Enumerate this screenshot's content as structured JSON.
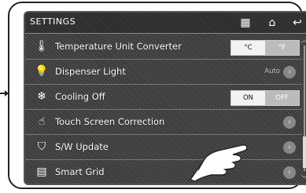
{
  "header": {
    "title": "SETTINGS"
  },
  "toolbar": {
    "icons": [
      "grid-settings-icon",
      "home-icon",
      "back-icon"
    ],
    "home_glyph": "⌂",
    "back_glyph": "↩",
    "grid_glyph": "▦"
  },
  "settings": {
    "temperature": {
      "label": "Temperature Unit Converter",
      "options": [
        "°C",
        "°F"
      ],
      "selected": "°C"
    },
    "dispenser": {
      "label": "Dispenser Light",
      "value": "Auto"
    },
    "cooling": {
      "label": "Cooling Off",
      "options": [
        "ON",
        "OFF"
      ],
      "selected": "ON"
    },
    "touch": {
      "label": "Touch Screen Correction"
    },
    "update": {
      "label": "S/W Update"
    },
    "smartgrid": {
      "label": "Smart Grid"
    }
  },
  "colors": {
    "screen_bg": "#3a3a3a",
    "text": "#ffffff"
  }
}
